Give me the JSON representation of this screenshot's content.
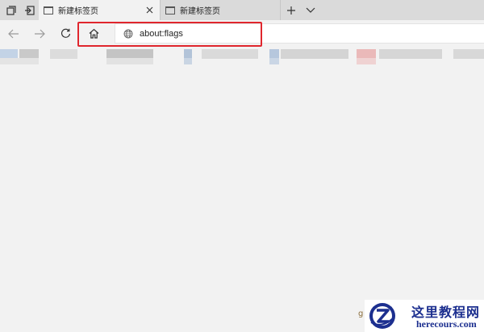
{
  "tabs": [
    {
      "title": "新建标签页",
      "active": true
    },
    {
      "title": "新建标签页",
      "active": false
    }
  ],
  "address": {
    "value": "about:flags"
  },
  "watermark": {
    "name": "这里教程网",
    "domain": "herecours.com",
    "side_char": "g"
  },
  "colors": {
    "highlight": "#e0262d",
    "tabstrip": "#dadada",
    "chrome": "#f2f2f2",
    "watermark_text": "#1c2f8f"
  },
  "icons": {
    "tab_preview": "tab-preview-icon",
    "set_aside": "set-aside-tabs-icon",
    "back": "back-arrow-icon",
    "forward": "forward-arrow-icon",
    "refresh": "refresh-icon",
    "home": "home-icon",
    "new_tab": "plus-icon",
    "tab_list": "chevron-down-icon",
    "close": "close-icon",
    "site": "globe-icon"
  }
}
